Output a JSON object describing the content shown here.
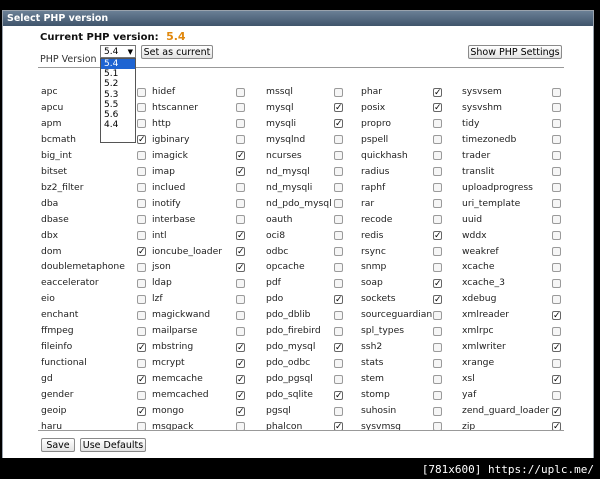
{
  "title": "Select PHP version",
  "current_label": "Current PHP version:",
  "current_version": "5.4",
  "php_version_label": "PHP Version",
  "select_value": "5.4",
  "select_options": [
    "5.4",
    "5.1",
    "5.2",
    "5.3",
    "5.5",
    "5.6",
    "4.4"
  ],
  "selected_option_index": 0,
  "set_current_label": "Set as current",
  "show_settings_label": "Show PHP Settings",
  "save_label": "Save",
  "defaults_label": "Use Defaults",
  "watermark": "[781x600] https://uplc.me/",
  "extensions": [
    [
      [
        "apc",
        false
      ],
      [
        "hidef",
        false
      ],
      [
        "mssql",
        false
      ],
      [
        "phar",
        true
      ],
      [
        "sysvsem",
        false
      ]
    ],
    [
      [
        "apcu",
        false
      ],
      [
        "htscanner",
        false
      ],
      [
        "mysql",
        true
      ],
      [
        "posix",
        true
      ],
      [
        "sysvshm",
        false
      ]
    ],
    [
      [
        "apm",
        false
      ],
      [
        "http",
        false
      ],
      [
        "mysqli",
        true
      ],
      [
        "propro",
        false
      ],
      [
        "tidy",
        false
      ]
    ],
    [
      [
        "bcmath",
        true
      ],
      [
        "igbinary",
        false
      ],
      [
        "mysqlnd",
        false
      ],
      [
        "pspell",
        false
      ],
      [
        "timezonedb",
        false
      ]
    ],
    [
      [
        "big_int",
        false
      ],
      [
        "imagick",
        true
      ],
      [
        "ncurses",
        false
      ],
      [
        "quickhash",
        false
      ],
      [
        "trader",
        false
      ]
    ],
    [
      [
        "bitset",
        false
      ],
      [
        "imap",
        true
      ],
      [
        "nd_mysql",
        false
      ],
      [
        "radius",
        false
      ],
      [
        "translit",
        false
      ]
    ],
    [
      [
        "bz2_filter",
        false
      ],
      [
        "inclued",
        false
      ],
      [
        "nd_mysqli",
        false
      ],
      [
        "raphf",
        false
      ],
      [
        "uploadprogress",
        false
      ]
    ],
    [
      [
        "dba",
        false
      ],
      [
        "inotify",
        false
      ],
      [
        "nd_pdo_mysql",
        false
      ],
      [
        "rar",
        false
      ],
      [
        "uri_template",
        false
      ]
    ],
    [
      [
        "dbase",
        false
      ],
      [
        "interbase",
        false
      ],
      [
        "oauth",
        false
      ],
      [
        "recode",
        false
      ],
      [
        "uuid",
        false
      ]
    ],
    [
      [
        "dbx",
        false
      ],
      [
        "intl",
        true
      ],
      [
        "oci8",
        false
      ],
      [
        "redis",
        true
      ],
      [
        "wddx",
        false
      ]
    ],
    [
      [
        "dom",
        true
      ],
      [
        "ioncube_loader",
        true
      ],
      [
        "odbc",
        false
      ],
      [
        "rsync",
        false
      ],
      [
        "weakref",
        false
      ]
    ],
    [
      [
        "doublemetaphone",
        false
      ],
      [
        "json",
        true
      ],
      [
        "opcache",
        false
      ],
      [
        "snmp",
        false
      ],
      [
        "xcache",
        false
      ]
    ],
    [
      [
        "eaccelerator",
        false
      ],
      [
        "ldap",
        false
      ],
      [
        "pdf",
        false
      ],
      [
        "soap",
        true
      ],
      [
        "xcache_3",
        false
      ]
    ],
    [
      [
        "eio",
        false
      ],
      [
        "lzf",
        false
      ],
      [
        "pdo",
        true
      ],
      [
        "sockets",
        true
      ],
      [
        "xdebug",
        false
      ]
    ],
    [
      [
        "enchant",
        false
      ],
      [
        "magickwand",
        false
      ],
      [
        "pdo_dblib",
        false
      ],
      [
        "sourceguardian",
        false
      ],
      [
        "xmlreader",
        true
      ]
    ],
    [
      [
        "ffmpeg",
        false
      ],
      [
        "mailparse",
        false
      ],
      [
        "pdo_firebird",
        false
      ],
      [
        "spl_types",
        false
      ],
      [
        "xmlrpc",
        false
      ]
    ],
    [
      [
        "fileinfo",
        true
      ],
      [
        "mbstring",
        true
      ],
      [
        "pdo_mysql",
        true
      ],
      [
        "ssh2",
        false
      ],
      [
        "xmlwriter",
        true
      ]
    ],
    [
      [
        "functional",
        false
      ],
      [
        "mcrypt",
        true
      ],
      [
        "pdo_odbc",
        false
      ],
      [
        "stats",
        false
      ],
      [
        "xrange",
        false
      ]
    ],
    [
      [
        "gd",
        true
      ],
      [
        "memcache",
        true
      ],
      [
        "pdo_pgsql",
        false
      ],
      [
        "stem",
        false
      ],
      [
        "xsl",
        true
      ]
    ],
    [
      [
        "gender",
        false
      ],
      [
        "memcached",
        true
      ],
      [
        "pdo_sqlite",
        true
      ],
      [
        "stomp",
        false
      ],
      [
        "yaf",
        false
      ]
    ],
    [
      [
        "geoip",
        true
      ],
      [
        "mongo",
        true
      ],
      [
        "pgsql",
        false
      ],
      [
        "suhosin",
        false
      ],
      [
        "zend_guard_loader",
        true
      ]
    ],
    [
      [
        "haru",
        false
      ],
      [
        "msgpack",
        false
      ],
      [
        "phalcon",
        true
      ],
      [
        "sysvmsg",
        false
      ],
      [
        "zip",
        true
      ]
    ]
  ]
}
